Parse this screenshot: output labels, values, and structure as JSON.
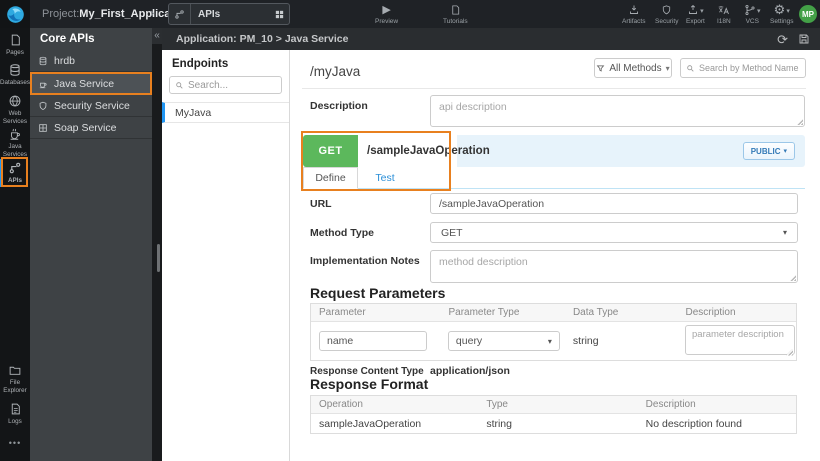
{
  "topbar": {
    "project_label": "Project:",
    "project_name": "My_First_Application",
    "tab_label": "APIs",
    "preview_label": "Preview",
    "tutorials_label": "Tutorials",
    "actions": {
      "artifacts": "Artifacts",
      "security": "Security",
      "export": "Export",
      "i18n": "I18N",
      "vcs": "VCS",
      "settings": "Settings"
    },
    "avatar": "MP"
  },
  "sidebar": {
    "items": [
      {
        "label": "Pages"
      },
      {
        "label": "Databases"
      },
      {
        "label": "Web Services"
      },
      {
        "label": "Java Services"
      },
      {
        "label": "APIs",
        "active": true
      }
    ],
    "bottom_items": [
      {
        "label": "File Explorer"
      },
      {
        "label": "Logs"
      }
    ],
    "more_label": "•••"
  },
  "core_apis": {
    "title": "Core APIs",
    "items": [
      {
        "label": "hrdb"
      },
      {
        "label": "Java Service",
        "highlighted": true
      },
      {
        "label": "Security Service"
      },
      {
        "label": "Soap Service"
      }
    ]
  },
  "breadcrumb": "Application: PM_10 > Java Service",
  "endpoints": {
    "title": "Endpoints",
    "search_placeholder": "Search...",
    "items": [
      {
        "label": "MyJava",
        "selected": true
      }
    ]
  },
  "main": {
    "title": "/myJava",
    "filter_label": "All Methods",
    "search_placeholder": "Search by Method Name or URL...",
    "description_label": "Description",
    "description_placeholder": "api description",
    "method": {
      "verb": "GET",
      "path": "/sampleJavaOperation",
      "visibility": "PUBLIC"
    },
    "tabs": [
      {
        "label": "Define",
        "active": true
      },
      {
        "label": "Test"
      }
    ],
    "form": {
      "url_label": "URL",
      "url_value": "/sampleJavaOperation",
      "method_type_label": "Method Type",
      "method_type_value": "GET",
      "impl_notes_label": "Implementation Notes",
      "impl_notes_placeholder": "method description"
    },
    "request_parameters": {
      "title": "Request Parameters",
      "headers": [
        "Parameter",
        "Parameter Type",
        "Data Type",
        "Description"
      ],
      "row": {
        "parameter": "name",
        "parameter_type": "query",
        "data_type": "string",
        "description_placeholder": "parameter description"
      }
    },
    "response": {
      "content_type_label": "Response Content Type",
      "content_type_value": "application/json",
      "format_title": "Response Format",
      "headers": [
        "Operation",
        "Type",
        "Description"
      ],
      "row": {
        "operation": "sampleJavaOperation",
        "type": "string",
        "description": "No description found"
      }
    }
  },
  "icons": {
    "caret_down": "▾",
    "play": "▶",
    "collapse": "«",
    "gear": "⚙",
    "refresh": "⟳",
    "chevron_right": "›"
  },
  "colors": {
    "annotation_orange": "#e8801f",
    "get_green": "#5cb85c",
    "selection_blue": "#2196f3",
    "link_blue": "#2b8fd8",
    "method_bar_blue": "#e7f3fb",
    "topbar_dark": "#1f2226",
    "panel_dark": "#3e4245"
  }
}
